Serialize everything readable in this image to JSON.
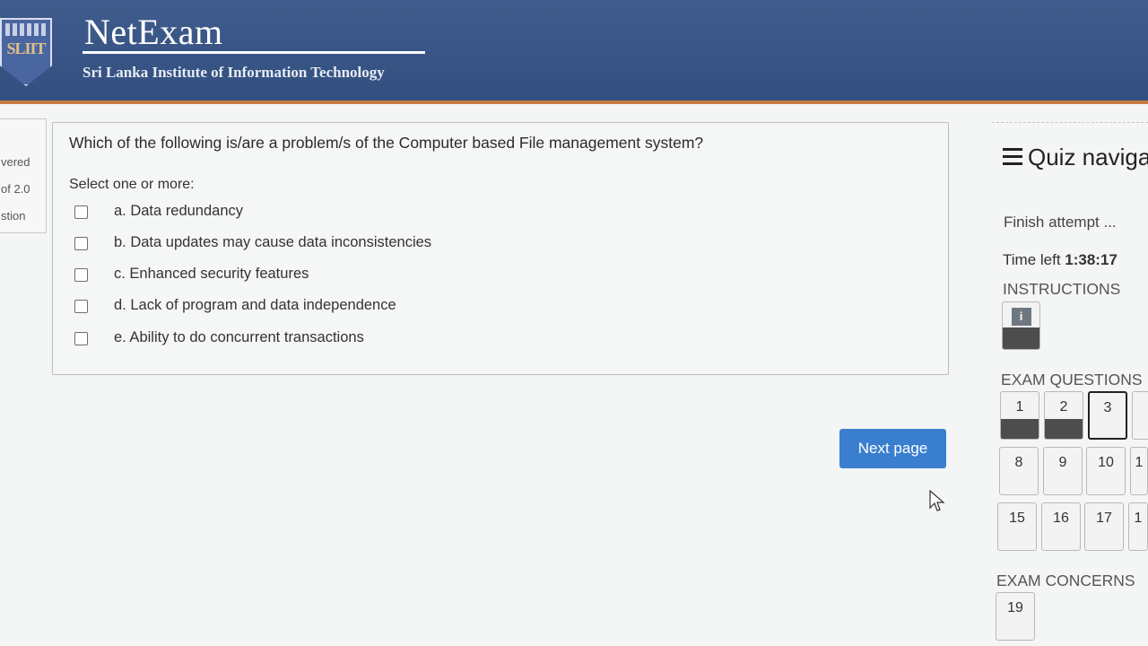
{
  "header": {
    "logo_text": "SLIIT",
    "title": "NetExam",
    "subtitle": "Sri Lanka Institute of Information Technology"
  },
  "info": {
    "line1": "vered",
    "line2": "of 2.0",
    "line3": "stion"
  },
  "question": {
    "text": "Which of the following is/are a problem/s of the Computer based File management system?",
    "prompt": "Select one or more:",
    "options": [
      {
        "label": "a. Data redundancy",
        "checked": false
      },
      {
        "label": "b. Data updates may cause data inconsistencies",
        "checked": false
      },
      {
        "label": "c. Enhanced security features",
        "checked": false
      },
      {
        "label": "d. Lack of program and data independence",
        "checked": false
      },
      {
        "label": "e. Ability to do concurrent transactions",
        "checked": false
      }
    ]
  },
  "next_button": "Next page",
  "nav": {
    "title": "Quiz naviga",
    "finish": "Finish attempt ...",
    "time_label": "Time left",
    "time_value": "1:38:17",
    "instructions_label": "INSTRUCTIONS",
    "instructions_icon": "i",
    "exam_questions_label": "EXAM QUESTIONS",
    "questions": [
      {
        "num": "1",
        "state": "answered"
      },
      {
        "num": "2",
        "state": "answered"
      },
      {
        "num": "3",
        "state": "current"
      },
      {
        "num": "",
        "state": "partial"
      },
      {
        "num": "8",
        "state": "unanswered"
      },
      {
        "num": "9",
        "state": "unanswered"
      },
      {
        "num": "10",
        "state": "unanswered"
      },
      {
        "num": "1",
        "state": "partial"
      },
      {
        "num": "15",
        "state": "unanswered"
      },
      {
        "num": "16",
        "state": "unanswered"
      },
      {
        "num": "17",
        "state": "unanswered"
      },
      {
        "num": "1",
        "state": "partial"
      }
    ],
    "exam_concerns_label": "EXAM CONCERNS",
    "concerns": [
      {
        "num": "19"
      }
    ]
  }
}
